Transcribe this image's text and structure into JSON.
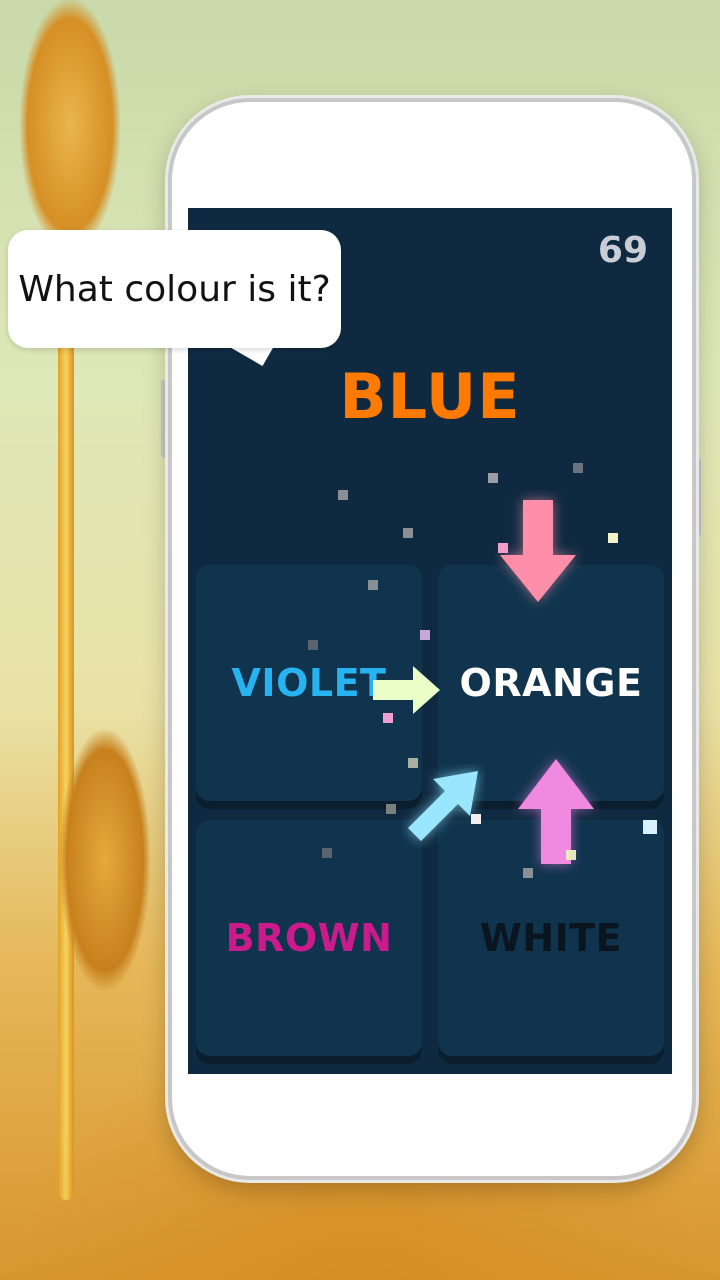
{
  "bubble": {
    "text": "What colour is it?"
  },
  "game": {
    "score": "69",
    "target_word": "BLUE",
    "target_word_color": "#ff7a00",
    "tiles": [
      {
        "label": "VIOLET",
        "color": "#27b3f0"
      },
      {
        "label": "ORANGE",
        "color": "#ffffff"
      },
      {
        "label": "BROWN",
        "color": "#cc1a8c"
      },
      {
        "label": "WHITE",
        "color": "#0a1520"
      }
    ]
  },
  "colors": {
    "screen_bg": "#0f2a40",
    "tile_bg": "#10344d"
  }
}
